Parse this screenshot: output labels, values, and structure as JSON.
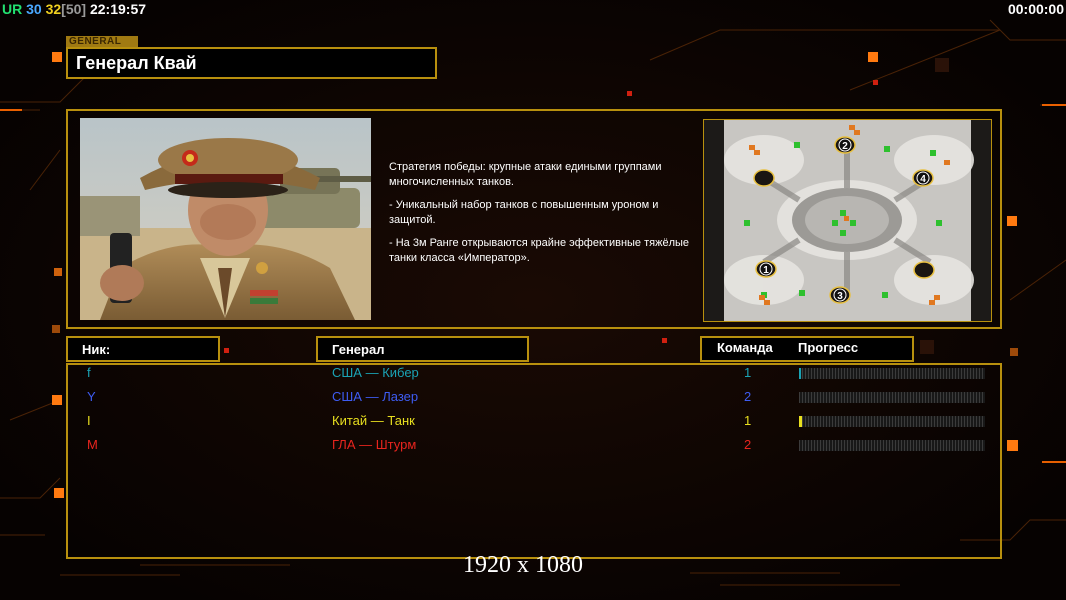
{
  "hud": {
    "label": "UR",
    "num1": "30",
    "num2": "32",
    "num3": "[50]",
    "clock": "22:19:57",
    "timer": "00:00:00"
  },
  "general": {
    "tag": "GENERAL",
    "name": "Генерал Квай",
    "description": [
      "Стратегия победы: крупные атаки едиными группами многочисленных танков.",
      "- Уникальный набор танков с повышенным уроном и защитой.",
      "- На 3м Ранге открываются крайне эффективные тяжёлые танки класса «Император»."
    ]
  },
  "map": {
    "start_labels": [
      "2",
      "4",
      "1",
      "3"
    ]
  },
  "table": {
    "col_nick": "Ник:",
    "col_general": "Генерал",
    "col_team": "Команда",
    "col_progress": "Прогресс"
  },
  "players": [
    {
      "nick": "f",
      "general": "США — Кибер",
      "team": "1",
      "color": "#1aa3b5",
      "progress": 0.01
    },
    {
      "nick": "Y",
      "general": "США — Лазер",
      "team": "2",
      "color": "#3e5cf2",
      "progress": 0.0
    },
    {
      "nick": "I",
      "general": "Китай — Танк",
      "team": "1",
      "color": "#e8df1f",
      "progress": 0.015
    },
    {
      "nick": "M",
      "general": "ГЛА — Штурм",
      "team": "2",
      "color": "#e8241e",
      "progress": 0.0
    }
  ],
  "overlay": {
    "resolution": "1920 x 1080"
  },
  "colors": {
    "frame": "#b8900e",
    "accent": "#ff6a00"
  }
}
